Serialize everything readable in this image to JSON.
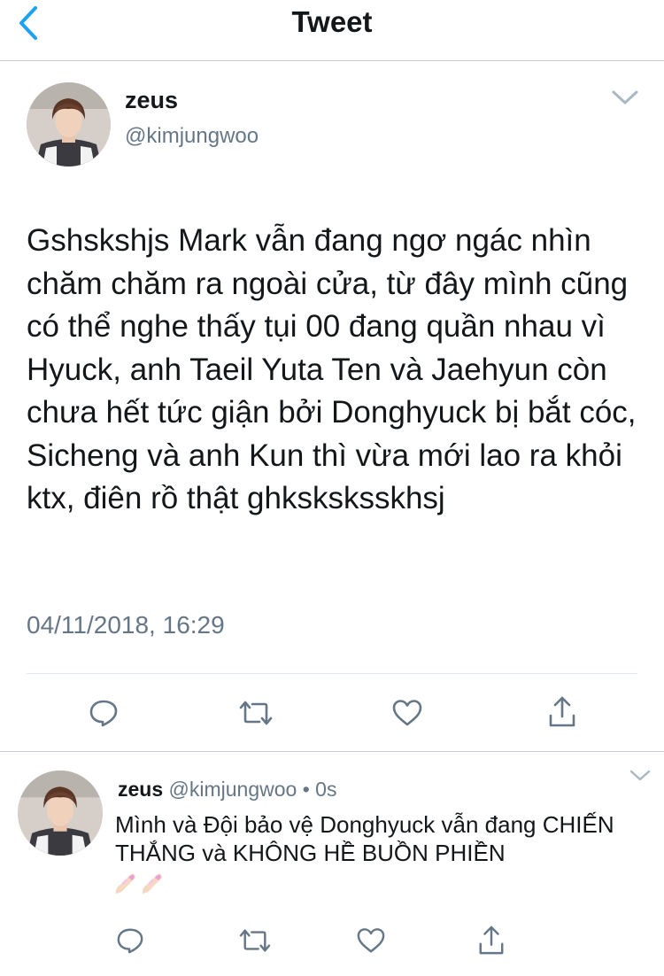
{
  "nav": {
    "title": "Tweet"
  },
  "tweet": {
    "name": "zeus",
    "handle": "@kimjungwoo",
    "text": "Gshskshjs Mark vẫn đang ngơ ngác nhìn chăm chăm ra ngoài cửa, từ đây mình cũng có thể nghe thấy tụi 00 đang quần nhau vì Hyuck, anh Taeil Yuta Ten và Jaehyun còn chưa hết tức giận bởi Donghyuck bị bắt cóc, Sicheng và anh Kun thì vừa mới lao ra khỏi ktx, điên rồ thật ghksksksskhsj",
    "date": "04/11/2018, 16:29"
  },
  "reply": {
    "name": "zeus",
    "handle": "@kimjungwoo",
    "separator": "•",
    "time": "0s",
    "text": "Mình và Đội bảo vệ Donghyuck vẫn đang CHIẾN THẮNG và KHÔNG HỀ BUỒN PHIỀN"
  },
  "icons": {
    "back": "chevron-left-icon",
    "caret": "chevron-down-icon",
    "reply": "reply-icon",
    "retweet": "retweet-icon",
    "like": "heart-icon",
    "share": "share-icon",
    "emoji": "nail-polish-emoji"
  },
  "colors": {
    "accent": "#1da1f2",
    "text": "#14171a",
    "secondary": "#657786",
    "divider": "#e1e8ed"
  }
}
